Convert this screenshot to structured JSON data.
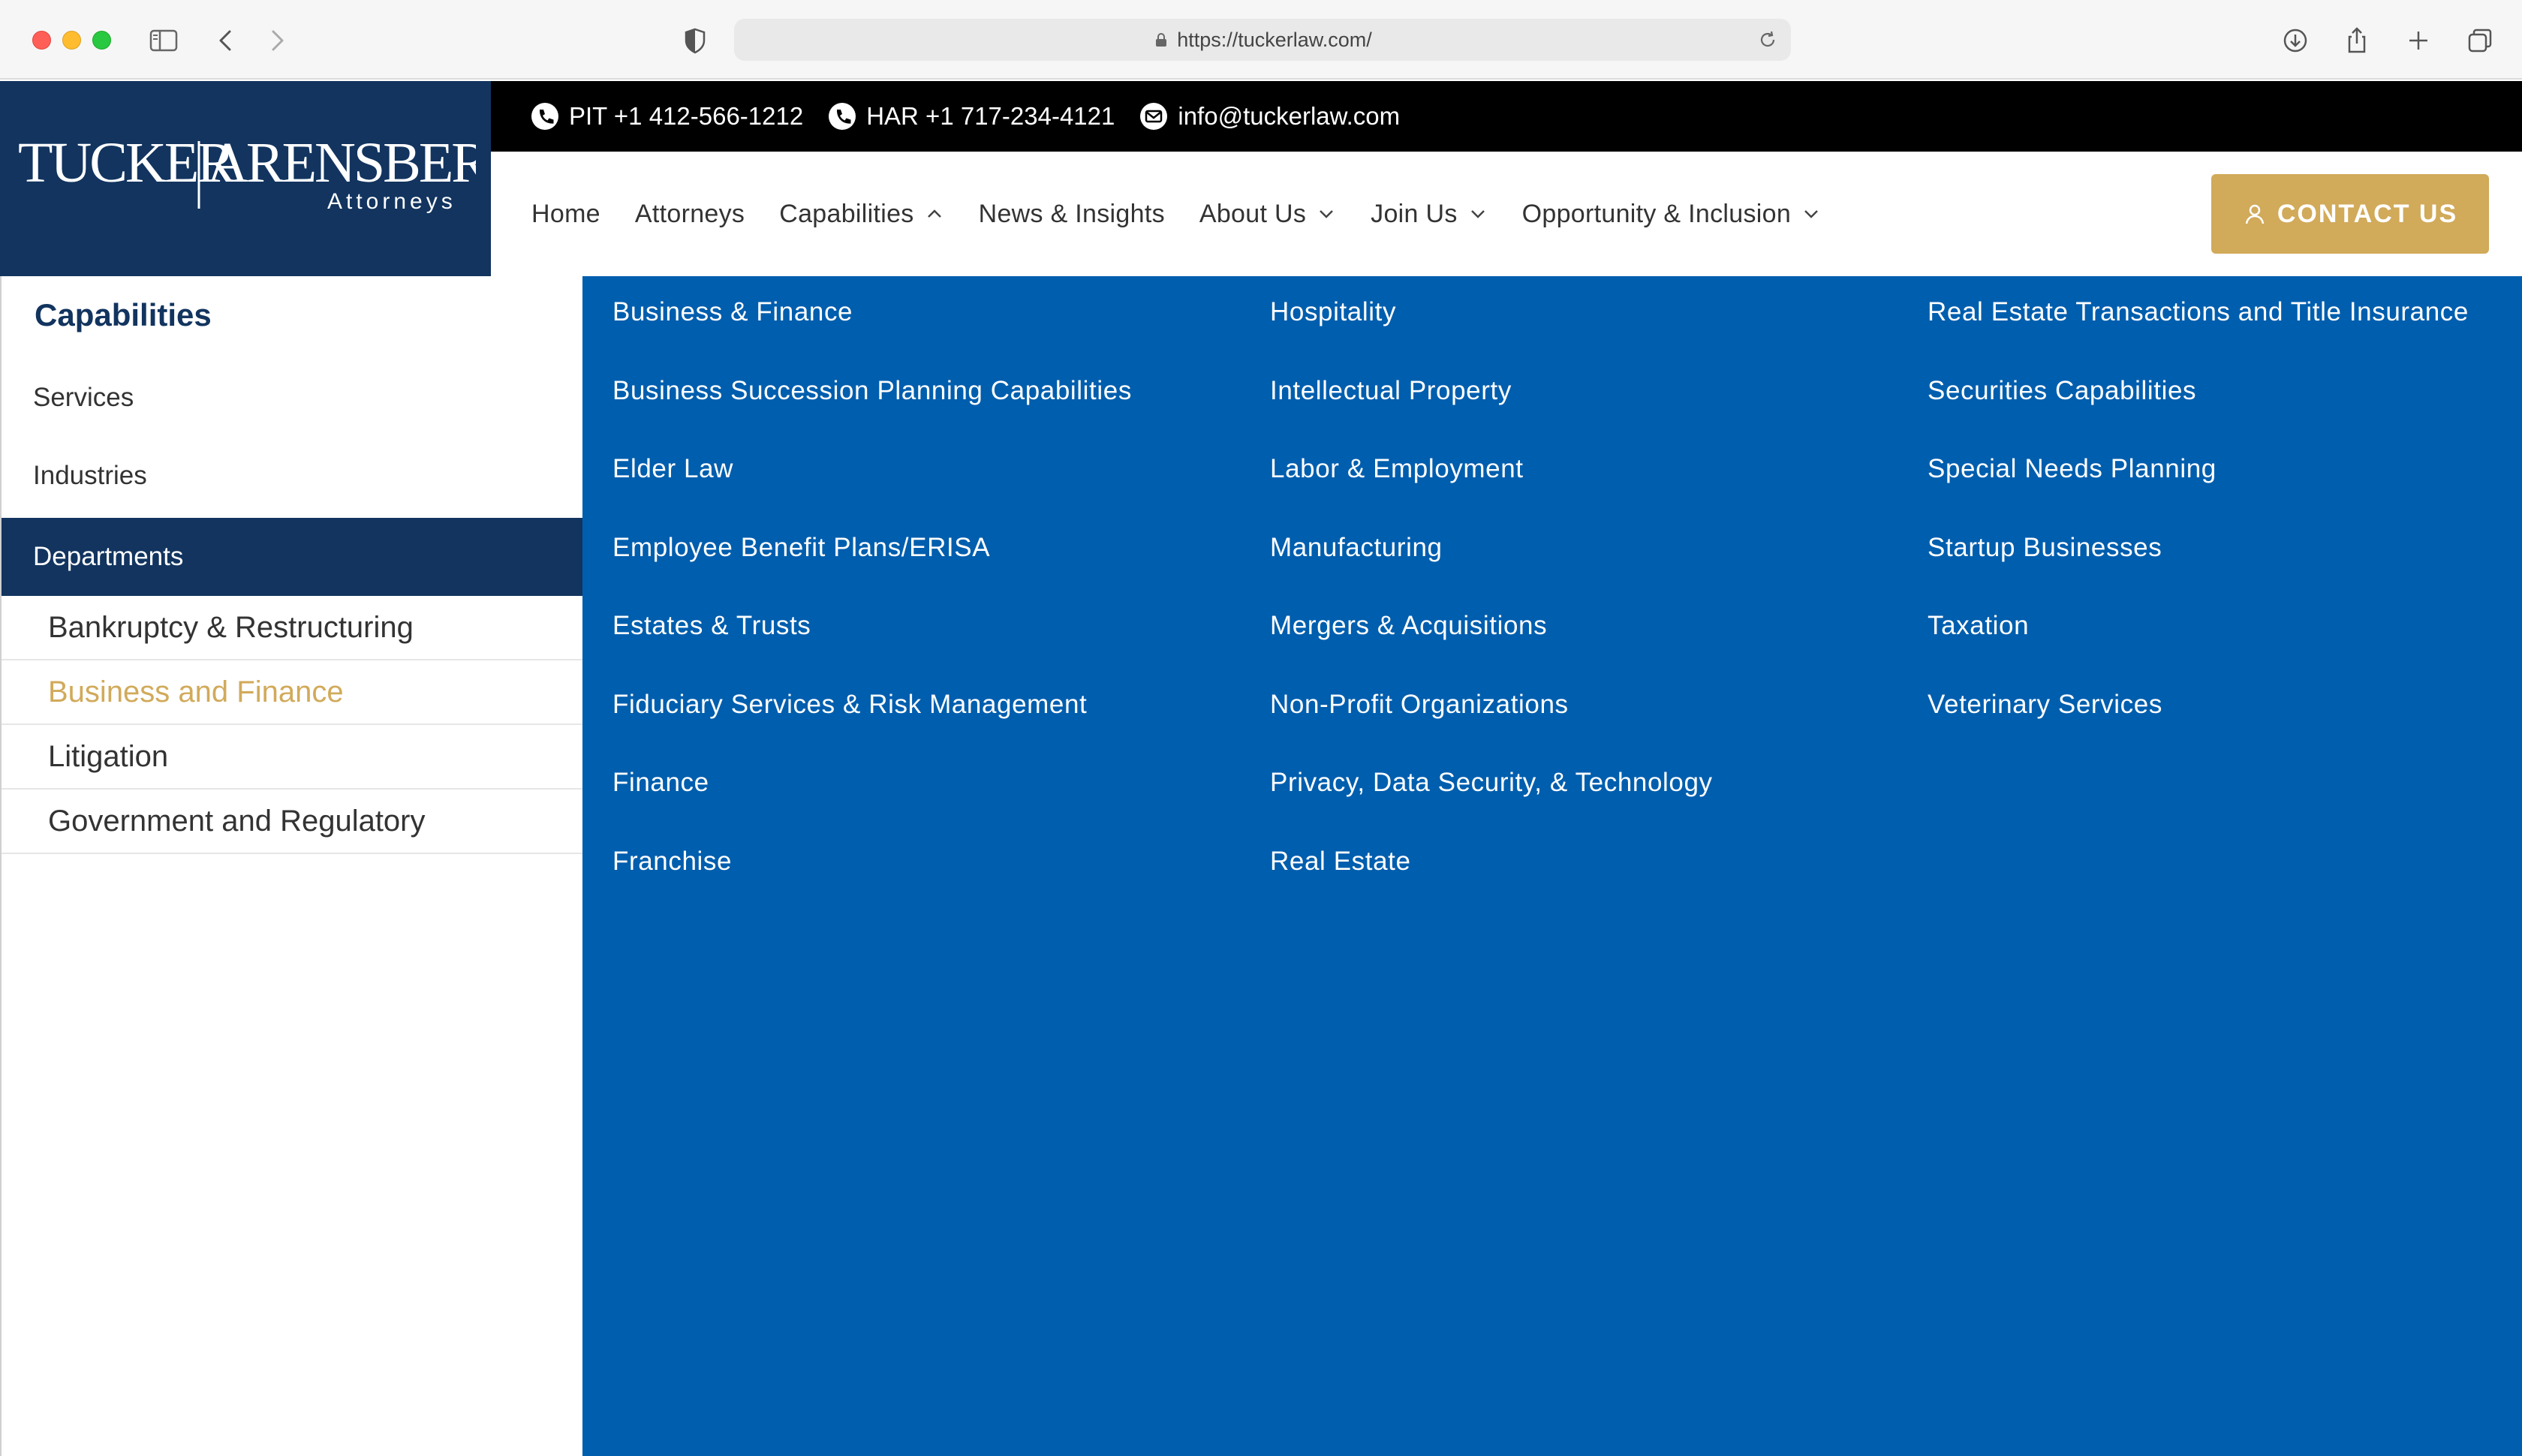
{
  "browser": {
    "url": "https://tuckerlaw.com/"
  },
  "logo": {
    "name_left": "TUCKER",
    "name_right": "ARENSBERG",
    "tagline": "Attorneys"
  },
  "topbar": {
    "phone_pit": "PIT +1 412-566-1212",
    "phone_har": "HAR +1 717-234-4121",
    "email": "info@tuckerlaw.com"
  },
  "nav": {
    "items": [
      {
        "label": "Home",
        "icon": ""
      },
      {
        "label": "Attorneys",
        "icon": ""
      },
      {
        "label": "Capabilities",
        "icon": "chevron-up-icon"
      },
      {
        "label": "News & Insights",
        "icon": ""
      },
      {
        "label": "About Us",
        "icon": "chevron-down-icon"
      },
      {
        "label": "Join Us",
        "icon": "chevron-down-icon"
      },
      {
        "label": "Opportunity & Inclusion",
        "icon": "chevron-down-icon"
      }
    ],
    "contact_label": "CONTACT US"
  },
  "leftmenu": {
    "title": "Capabilities",
    "items": [
      "Services",
      "Industries",
      "Departments"
    ],
    "subitems": [
      {
        "label": "Bankruptcy & Restructuring",
        "active": false
      },
      {
        "label": "Business and Finance",
        "active": true
      },
      {
        "label": "Litigation",
        "active": false
      },
      {
        "label": "Government and Regulatory",
        "active": false
      }
    ]
  },
  "megamenu": {
    "columns": [
      [
        "Business & Finance",
        "Business Succession Planning Capabilities",
        "Elder Law",
        "Employee Benefit Plans/ERISA",
        "Estates & Trusts",
        "Fiduciary Services & Risk Management",
        "Finance",
        "Franchise"
      ],
      [
        "Hospitality",
        "Intellectual Property",
        "Labor & Employment",
        "Manufacturing",
        "Mergers & Acquisitions",
        "Non-Profit Organizations",
        "Privacy, Data Security, & Technology",
        "Real Estate"
      ],
      [
        "Real Estate Transactions and Title Insurance",
        "Securities Capabilities",
        "Special Needs Planning",
        "Startup Businesses",
        "Taxation",
        "Veterinary Services"
      ]
    ]
  },
  "colors": {
    "navy": "#12345f",
    "mega_blue": "#005eae",
    "gold": "#d1aa5a"
  }
}
